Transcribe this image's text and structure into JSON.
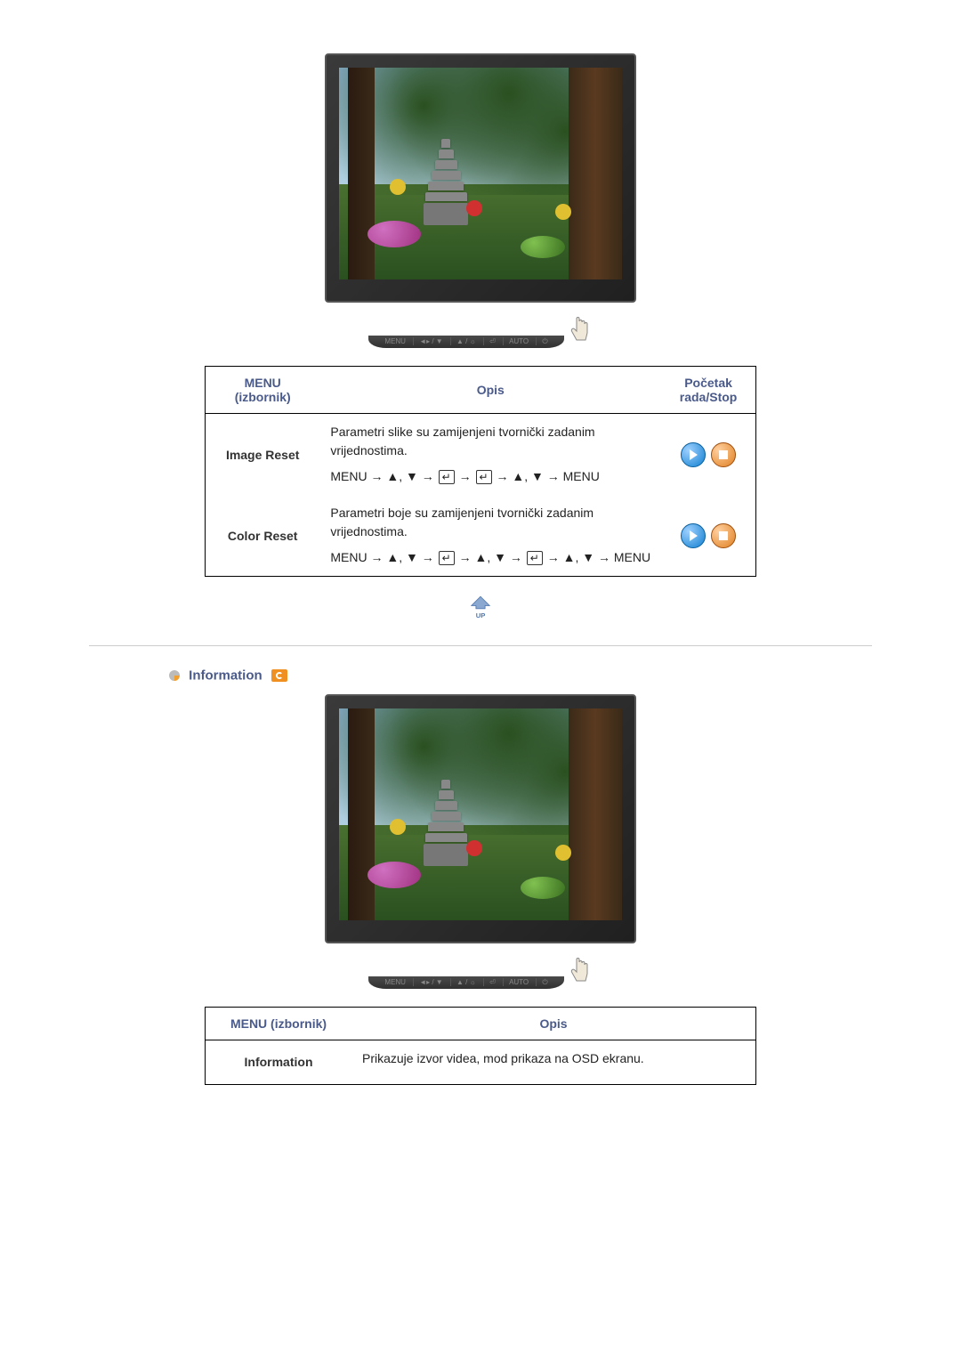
{
  "table1": {
    "headers": {
      "menu": "MENU (izbornik)",
      "desc": "Opis",
      "action": "Početak rada/Stop"
    },
    "rows": [
      {
        "label": "Image Reset",
        "desc": "Parametri slike su zamijenjeni tvornički zadanim vrijednostima.",
        "nav": "MENU → ▲, ▼ → ⏎ → ⏎ → ▲, ▼ → MENU"
      },
      {
        "label": "Color Reset",
        "desc": "Parametri boje su zamijenjeni tvornički zadanim vrijednostima.",
        "nav": "MENU → ▲, ▼ → ⏎ → ▲, ▼ → ⏎ → ▲, ▼ → MENU"
      }
    ]
  },
  "up_label": "UP",
  "section2": {
    "title": "Information"
  },
  "table2": {
    "headers": {
      "menu": "MENU (izbornik)",
      "desc": "Opis"
    },
    "rows": [
      {
        "label": "Information",
        "desc": "Prikazuje izvor videa, mod prikaza na OSD ekranu."
      }
    ]
  },
  "control_buttons": {
    "b1": "MENU",
    "b2": "◄▸ / ▼",
    "b3": "▲ / ☼",
    "b4": "⏎",
    "b5": "AUTO",
    "b6": "⏻"
  }
}
